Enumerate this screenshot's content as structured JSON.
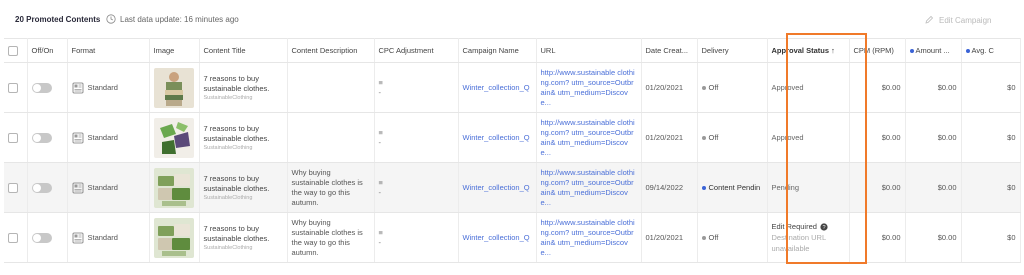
{
  "header": {
    "count_label": "20 Promoted Contents",
    "last_update": "Last data update: 16 minutes ago",
    "edit_campaign": "Edit Campaign"
  },
  "columns": {
    "onoff": "Off/On",
    "format": "Format",
    "image": "Image",
    "content_title": "Content Title",
    "content_description": "Content Description",
    "cpc_adjustment": "CPC Adjustment",
    "campaign_name": "Campaign Name",
    "url": "URL",
    "date_created": "Date Creat...",
    "delivery": "Delivery",
    "approval_status": "Approval Status ↑",
    "cpm": "CPM (RPM)",
    "amount": "Amount ...",
    "avg": "Avg. C"
  },
  "colors": {
    "highlight": "#f07a2a",
    "link": "#4a6fd8",
    "pending_dot": "#3a63d6",
    "off_dot": "#999999"
  },
  "rows": [
    {
      "format": "Standard",
      "image_icon": "clothes-stack-photo",
      "title": "7 reasons to buy sustainable clothes.",
      "brand": "SustainableClothing",
      "description": "",
      "cpc_symbol": "≡",
      "cpc_value": "-",
      "campaign": "Winter_collection_Q",
      "url": "http://www.sustainable clothing.com? utm_source=Outbrain& utm_medium=Discove...",
      "date": "01/20/2021",
      "delivery": "Off",
      "approval": "Approved",
      "approval_sub": "",
      "cpm": "$0.00",
      "amount": "$0.00",
      "avg": "$0"
    },
    {
      "format": "Standard",
      "image_icon": "green-sweaters-photo",
      "title": "7 reasons to buy sustainable clothes.",
      "brand": "SustainableClothing",
      "description": "",
      "cpc_symbol": "≡",
      "cpc_value": "-",
      "campaign": "Winter_collection_Q",
      "url": "http://www.sustainable clothing.com? utm_source=Outbrain& utm_medium=Discove...",
      "date": "01/20/2021",
      "delivery": "Off",
      "approval": "Approved",
      "approval_sub": "",
      "cpm": "$0.00",
      "amount": "$0.00",
      "avg": "$0"
    },
    {
      "format": "Standard",
      "image_icon": "folded-clothes-photo",
      "title": "7 reasons to buy sustainable clothes.",
      "brand": "SustainableClothing",
      "description": "Why buying sustainable clothes is the way to go this autumn.",
      "cpc_symbol": "≡",
      "cpc_value": "-",
      "campaign": "Winter_collection_Q",
      "url": "http://www.sustainable clothing.com? utm_source=Outbrain& utm_medium=Discove...",
      "date": "09/14/2022",
      "delivery": "Content Pendin",
      "approval": "Pending",
      "approval_sub": "",
      "cpm": "$0.00",
      "amount": "$0.00",
      "avg": "$0"
    },
    {
      "format": "Standard",
      "image_icon": "folded-clothes-photo",
      "title": "7 reasons to buy sustainable clothes.",
      "brand": "SustainableClothing",
      "description": "Why buying sustainable clothes is the way to go this autumn.",
      "cpc_symbol": "≡",
      "cpc_value": "-",
      "campaign": "Winter_collection_Q",
      "url": "http://www.sustainable clothing.com? utm_source=Outbrain& utm_medium=Discove...",
      "date": "01/20/2021",
      "delivery": "Off",
      "approval": "Edit Required",
      "approval_sub": "Destination URL unavailable",
      "cpm": "$0.00",
      "amount": "$0.00",
      "avg": "$0"
    }
  ]
}
